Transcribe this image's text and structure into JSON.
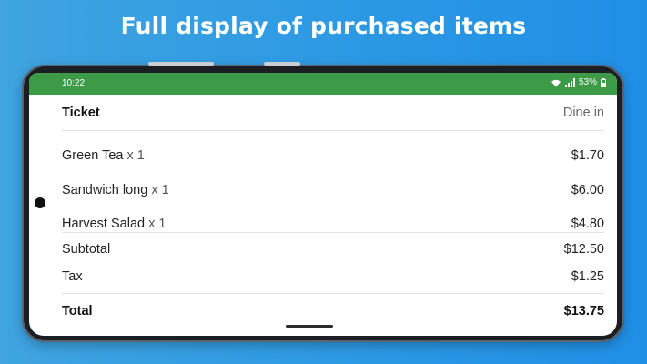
{
  "headline": "Full display of purchased items",
  "status_bar": {
    "time": "10:22",
    "battery": "53%",
    "icons": [
      "wifi-icon",
      "signal-icon",
      "battery-icon"
    ]
  },
  "ticket": {
    "title": "Ticket",
    "order_type": "Dine in",
    "items": [
      {
        "name": "Green Tea",
        "qty": "x 1",
        "price": "$1.70"
      },
      {
        "name": "Sandwich long",
        "qty": "x 1",
        "price": "$6.00"
      },
      {
        "name": "Harvest Salad",
        "qty": "x 1",
        "price": "$4.80"
      }
    ],
    "subtotal_label": "Subtotal",
    "subtotal": "$12.50",
    "tax_label": "Tax",
    "tax": "$1.25",
    "total_label": "Total",
    "total": "$13.75"
  },
  "colors": {
    "status_bar": "#3d9a47",
    "background": "#2f9be3"
  }
}
